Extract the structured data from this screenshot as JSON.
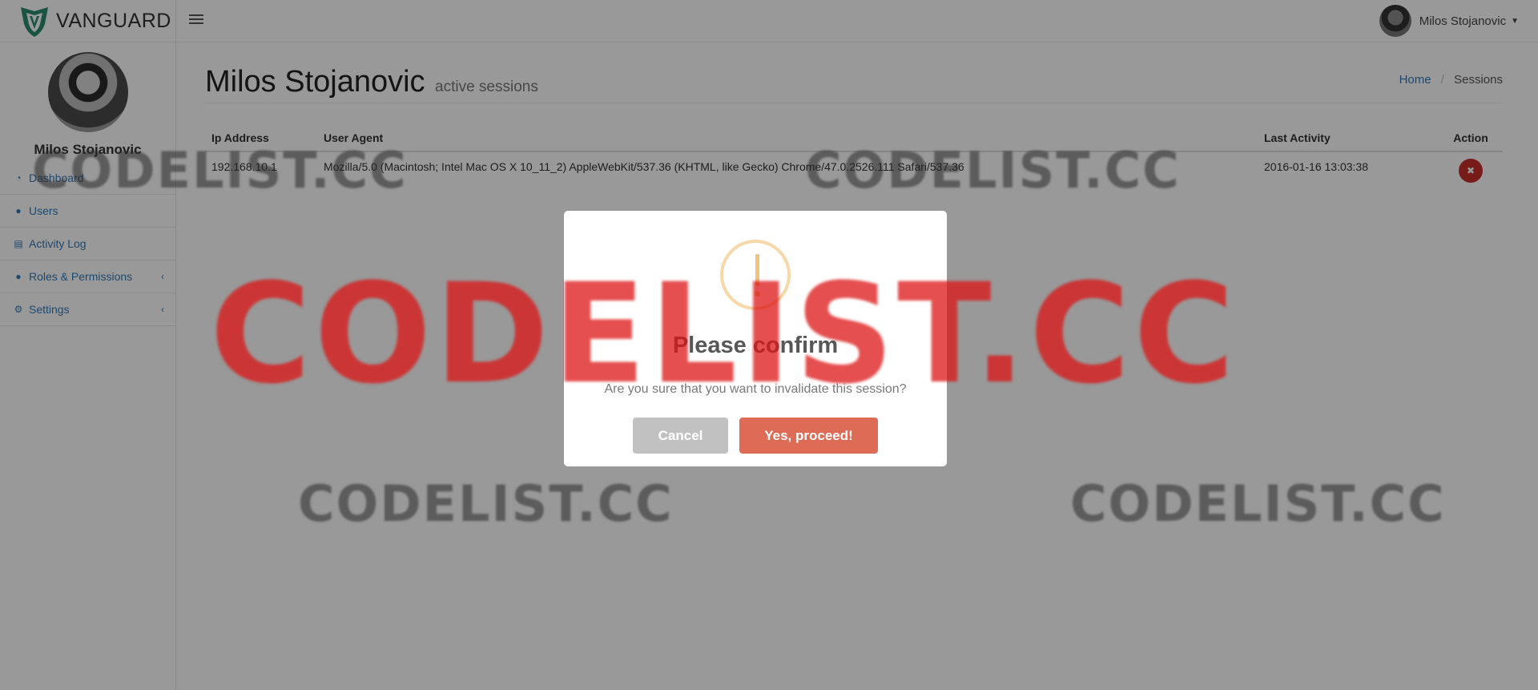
{
  "brand": {
    "name": "VANGUARD"
  },
  "topbar": {
    "user_name": "Milos Stojanovic"
  },
  "sidebar": {
    "profile_name": "Milos Stojanovic",
    "items": [
      {
        "label": "Dashboard",
        "icon": "dashboard-icon"
      },
      {
        "label": "Users",
        "icon": "users-icon"
      },
      {
        "label": "Activity Log",
        "icon": "activity-log-icon"
      },
      {
        "label": "Roles & Permissions",
        "icon": "user-icon",
        "has_submenu": true
      },
      {
        "label": "Settings",
        "icon": "gear-icon",
        "has_submenu": true
      }
    ]
  },
  "page": {
    "title": "Milos Stojanovic",
    "subtitle": "active sessions",
    "breadcrumb": {
      "home": "Home",
      "current": "Sessions"
    }
  },
  "table": {
    "headers": [
      "Ip Address",
      "User Agent",
      "Last Activity",
      "Action"
    ],
    "rows": [
      {
        "ip": "192.168.10.1",
        "agent": "Mozilla/5.0 (Macintosh; Intel Mac OS X 10_11_2) AppleWebKit/537.36 (KHTML, like Gecko) Chrome/47.0.2526.111 Safari/537.36",
        "last_activity": "2016-01-16 13:03:38"
      }
    ]
  },
  "modal": {
    "title": "Please confirm",
    "text": "Are you sure that you want to invalidate this session?",
    "cancel_label": "Cancel",
    "confirm_label": "Yes, proceed!",
    "icon": "warning-icon"
  },
  "watermark": {
    "text": "CODELIST.CC"
  },
  "colors": {
    "link": "#337ab7",
    "danger": "#c9302c",
    "confirm": "#dd6b55",
    "cancel": "#c1c1c1",
    "warning": "#f2c27a"
  }
}
